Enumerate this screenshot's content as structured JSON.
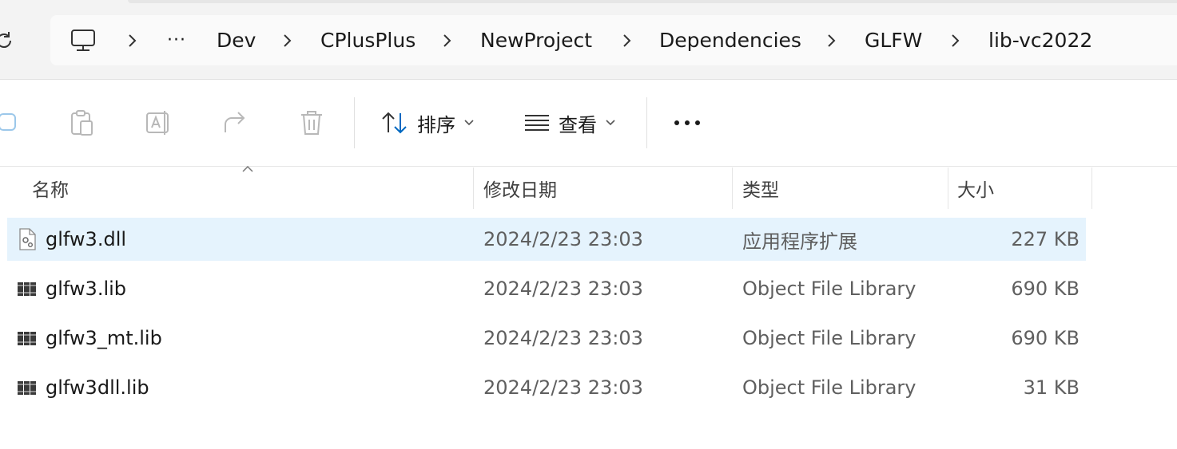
{
  "breadcrumb": {
    "items": [
      "Dev",
      "CPlusPlus",
      "NewProject",
      "Dependencies",
      "GLFW",
      "lib-vc2022"
    ],
    "overflow_label": "···"
  },
  "toolbar": {
    "sort_label": "排序",
    "view_label": "查看",
    "more_label": "•••",
    "icons": [
      "copy-icon",
      "paste-icon",
      "rename-icon",
      "share-icon",
      "delete-icon"
    ]
  },
  "columns": {
    "name": "名称",
    "modified": "修改日期",
    "type": "类型",
    "size": "大小"
  },
  "files": [
    {
      "name": "glfw3.dll",
      "modified": "2024/2/23 23:03",
      "type": "应用程序扩展",
      "size": "227 KB",
      "icon": "dll-file-icon",
      "selected": true
    },
    {
      "name": "glfw3.lib",
      "modified": "2024/2/23 23:03",
      "type": "Object File Library",
      "size": "690 KB",
      "icon": "lib-file-icon",
      "selected": false
    },
    {
      "name": "glfw3_mt.lib",
      "modified": "2024/2/23 23:03",
      "type": "Object File Library",
      "size": "690 KB",
      "icon": "lib-file-icon",
      "selected": false
    },
    {
      "name": "glfw3dll.lib",
      "modified": "2024/2/23 23:03",
      "type": "Object File Library",
      "size": "31 KB",
      "icon": "lib-file-icon",
      "selected": false
    }
  ],
  "colors": {
    "selection": "#e5f3fd",
    "accent": "#0067c0"
  }
}
